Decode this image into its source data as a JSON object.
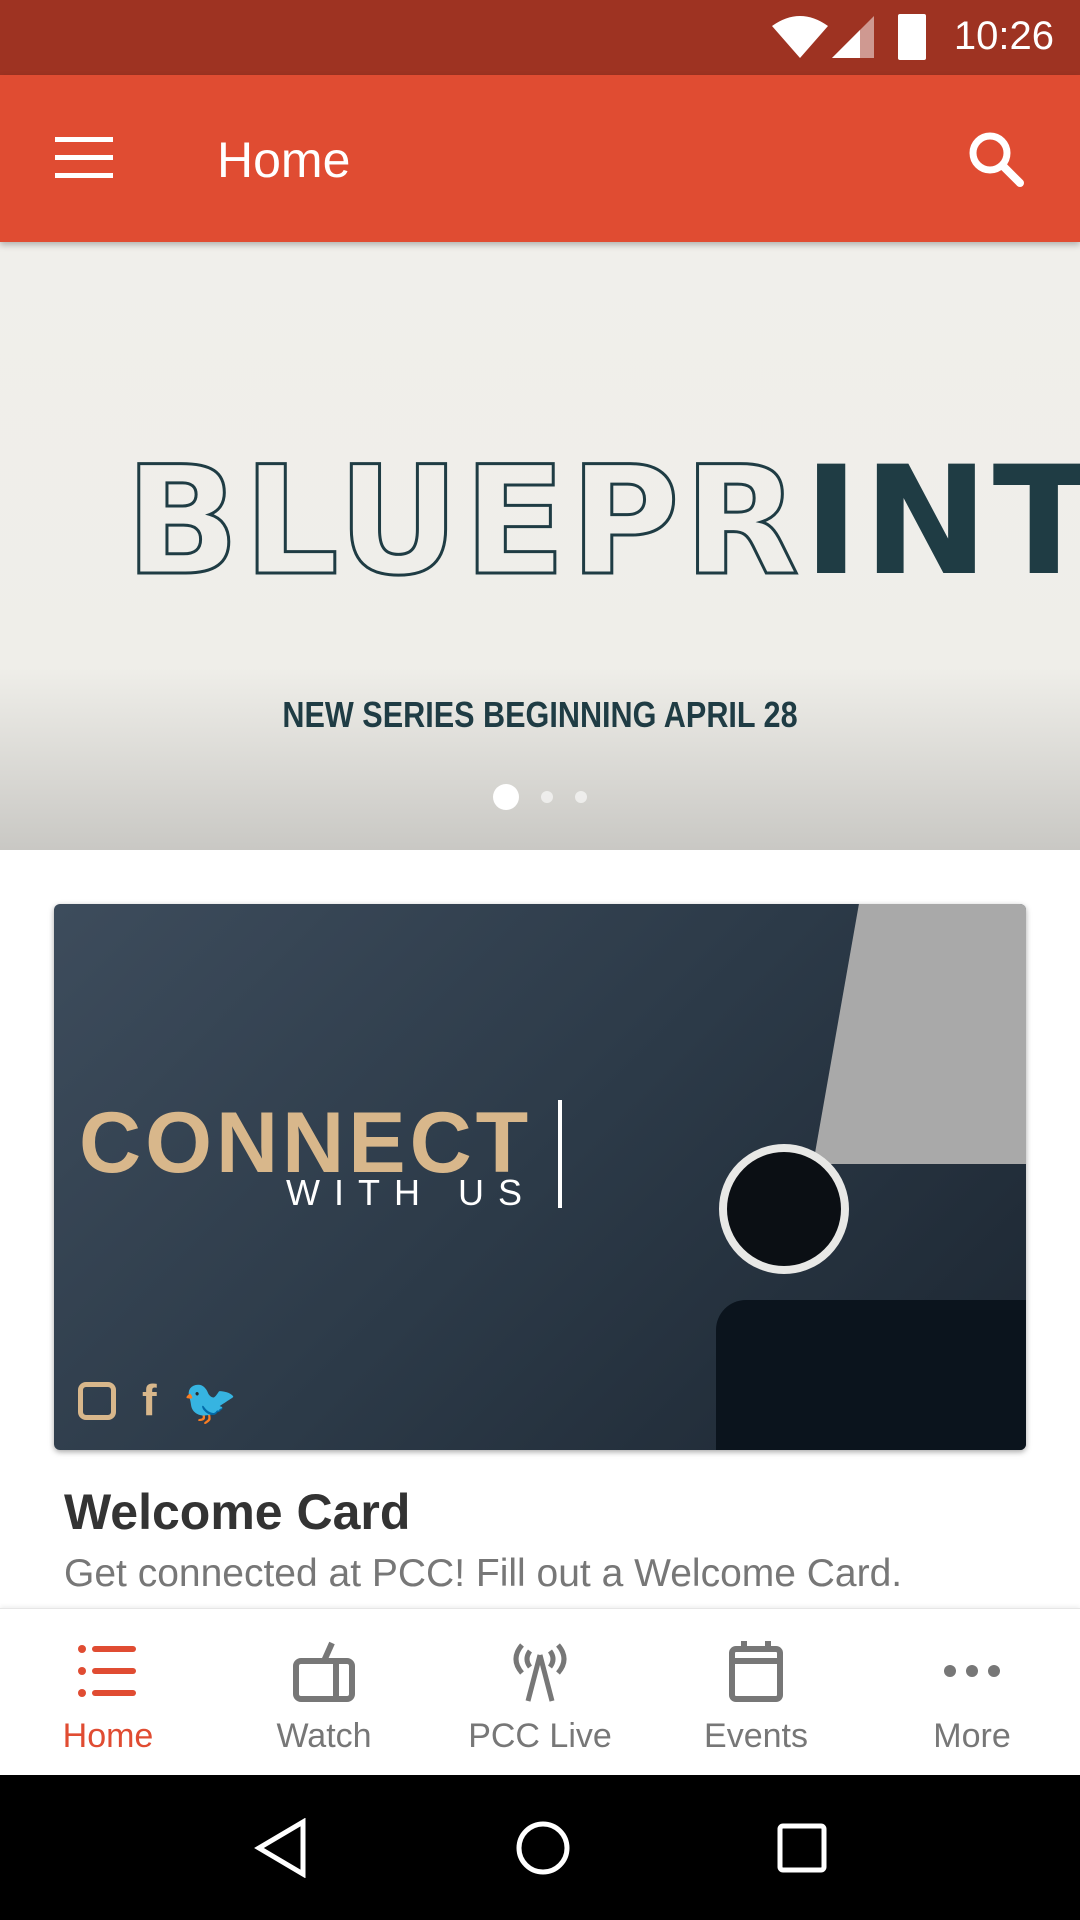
{
  "status_bar": {
    "time": "10:26",
    "icons": [
      "wifi-icon",
      "signal-icon",
      "battery-icon"
    ]
  },
  "app_bar": {
    "title": "Home",
    "menu_icon": "hamburger-icon",
    "search_icon": "search-icon"
  },
  "banner": {
    "logo_text": "BLUEPRINT",
    "subtitle": "NEW SERIES BEGINNING APRIL 28",
    "slide_count": 3,
    "active_slide": 1
  },
  "card": {
    "image_heading": "CONNECT",
    "image_subheading": "WITH US",
    "title": "Welcome Card",
    "description": "Get connected at PCC!  Fill out a Welcome Card.",
    "social_icons": [
      "instagram-icon",
      "facebook-icon",
      "twitter-icon"
    ]
  },
  "bottom_nav": {
    "items": [
      {
        "label": "Home",
        "icon": "list-icon",
        "active": true
      },
      {
        "label": "Watch",
        "icon": "tv-icon"
      },
      {
        "label": "PCC Live",
        "icon": "broadcast-icon"
      },
      {
        "label": "Events",
        "icon": "calendar-icon"
      },
      {
        "label": "More",
        "icon": "more-icon"
      }
    ]
  },
  "colors": {
    "primary": "#e04c32",
    "status_bar": "#9e3322",
    "inactive": "#777777"
  }
}
